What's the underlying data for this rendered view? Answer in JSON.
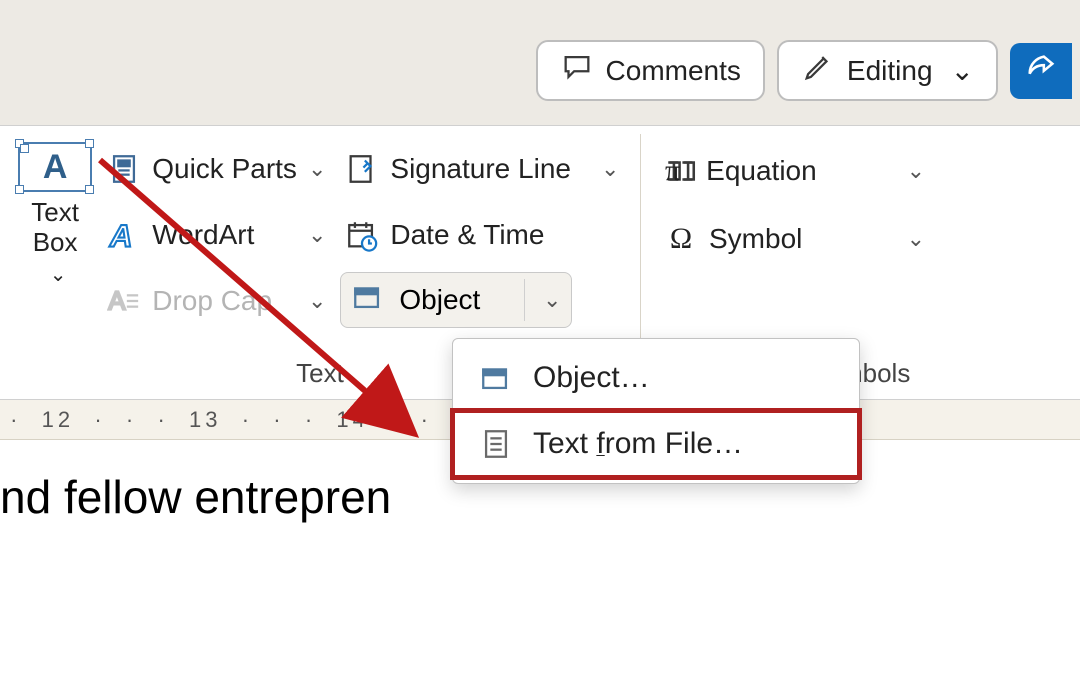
{
  "header": {
    "comments": "Comments",
    "editing": "Editing"
  },
  "ribbon": {
    "text_group_label": "Text",
    "symbols_group_label": "Symbols",
    "text_box": {
      "label_line1": "Text",
      "label_line2": "Box"
    },
    "quick_parts": "Quick Parts",
    "word_art": "WordArt",
    "drop_cap": "Drop Cap",
    "signature_line": "Signature Line",
    "date_time": "Date & Time",
    "object": "Object",
    "equation": "Equation",
    "symbol": "Symbol"
  },
  "object_menu": {
    "object": "Object…",
    "text_from_file_pre": "Text ",
    "text_from_file_acc": "f",
    "text_from_file_post": "rom File…"
  },
  "ruler": {
    "marks": [
      "12",
      "13",
      "14"
    ]
  },
  "document": {
    "visible_text": "nd fellow entrepren"
  }
}
